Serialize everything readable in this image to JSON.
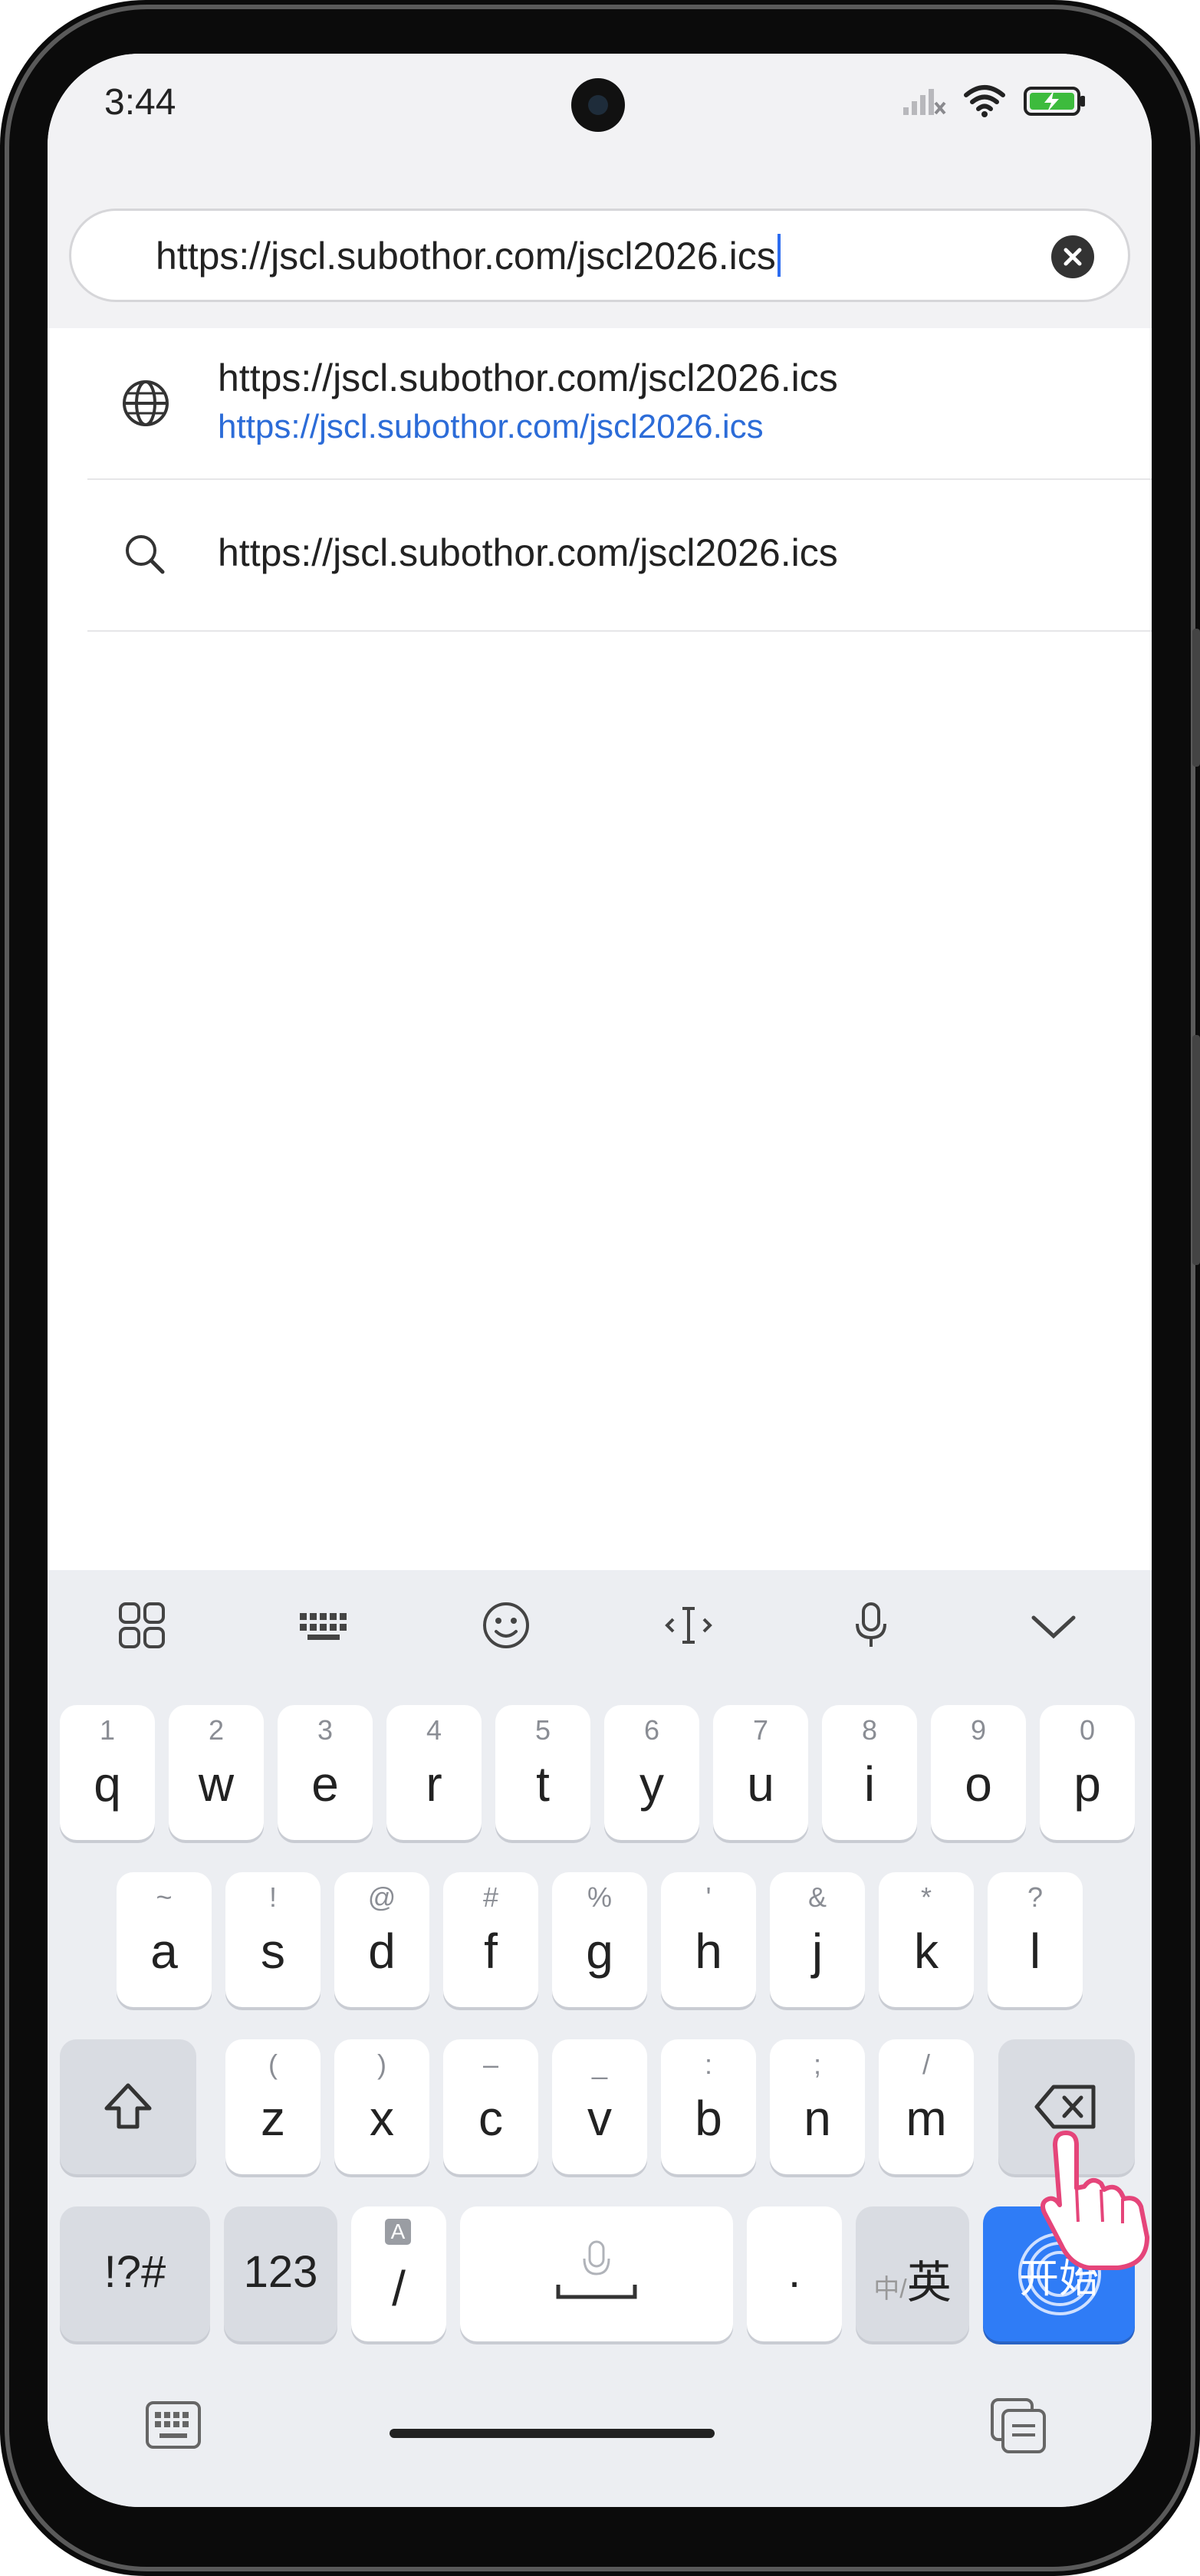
{
  "status_bar": {
    "time": "3:44",
    "icons": [
      "signal-off-icon",
      "wifi-icon",
      "battery-charging-icon"
    ]
  },
  "url_bar": {
    "value": "https://jscl.subothor.com/jscl2026.ics",
    "clear_icon": "close-icon"
  },
  "suggestions": [
    {
      "icon": "globe-icon",
      "title": "https://jscl.subothor.com/jscl2026.ics",
      "subtitle": "https://jscl.subothor.com/jscl2026.ics"
    },
    {
      "icon": "search-icon",
      "title": "https://jscl.subothor.com/jscl2026.ics"
    }
  ],
  "keyboard": {
    "toolbar": [
      "apps-grid-icon",
      "keyboard-layout-icon",
      "emoji-icon",
      "cursor-icon",
      "mic-icon",
      "chevron-down-icon"
    ],
    "row1": [
      {
        "main": "q",
        "sec": "1"
      },
      {
        "main": "w",
        "sec": "2"
      },
      {
        "main": "e",
        "sec": "3"
      },
      {
        "main": "r",
        "sec": "4"
      },
      {
        "main": "t",
        "sec": "5"
      },
      {
        "main": "y",
        "sec": "6"
      },
      {
        "main": "u",
        "sec": "7"
      },
      {
        "main": "i",
        "sec": "8"
      },
      {
        "main": "o",
        "sec": "9"
      },
      {
        "main": "p",
        "sec": "0"
      }
    ],
    "row2": [
      {
        "main": "a",
        "sec": "~"
      },
      {
        "main": "s",
        "sec": "!"
      },
      {
        "main": "d",
        "sec": "@"
      },
      {
        "main": "f",
        "sec": "#"
      },
      {
        "main": "g",
        "sec": "%"
      },
      {
        "main": "h",
        "sec": "'"
      },
      {
        "main": "j",
        "sec": "&"
      },
      {
        "main": "k",
        "sec": "*"
      },
      {
        "main": "l",
        "sec": "?"
      }
    ],
    "row3": [
      {
        "main": "z",
        "sec": "("
      },
      {
        "main": "x",
        "sec": ")"
      },
      {
        "main": "c",
        "sec": "–"
      },
      {
        "main": "v",
        "sec": "_"
      },
      {
        "main": "b",
        "sec": ":"
      },
      {
        "main": "n",
        "sec": ";"
      },
      {
        "main": "m",
        "sec": "/"
      }
    ],
    "symbols_label": "!?#",
    "numbers_label": "123",
    "slash_label": "/",
    "slash_badge": "A",
    "period_label": ".",
    "lang_small": "中/",
    "lang_big": "英",
    "enter_label": "开始",
    "bottom_left_icon": "keyboard-hide-icon",
    "bottom_right_icon": "clipboard-icon"
  }
}
